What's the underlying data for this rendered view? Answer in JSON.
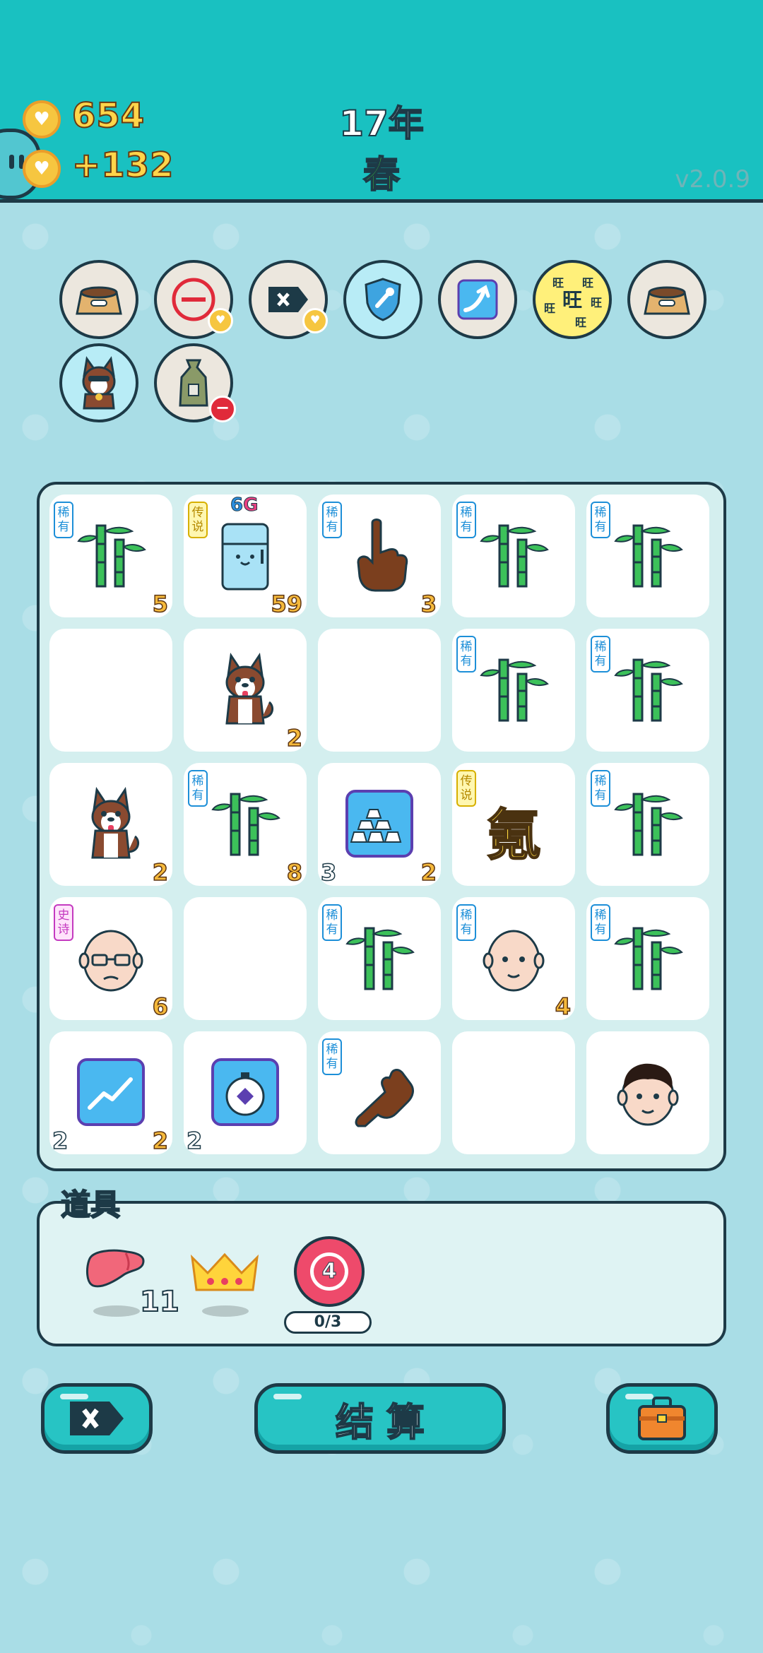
{
  "header": {
    "coins": "654",
    "income": "+132",
    "year": "17年",
    "season": "春",
    "version": "v2.0.9"
  },
  "relics": [
    {
      "name": "pet-food-bowl"
    },
    {
      "name": "no-entry-sign"
    },
    {
      "name": "remove-tag"
    },
    {
      "name": "shield-wrench"
    },
    {
      "name": "arrow-card"
    },
    {
      "name": "wang-coin",
      "text": "旺"
    },
    {
      "name": "pet-food-bowl-2"
    },
    {
      "name": "husky-dog"
    },
    {
      "name": "sack"
    }
  ],
  "tags": {
    "rare": "稀有",
    "legend": "传说",
    "epic": "史诗"
  },
  "board": {
    "cells": [
      {
        "item": "bamboo",
        "tag": "rare",
        "value": "5"
      },
      {
        "item": "fridge",
        "tag": "legend",
        "value": "59",
        "top": "6",
        "top2": "G"
      },
      {
        "item": "pointing-finger",
        "tag": "rare",
        "value": "3"
      },
      {
        "item": "bamboo",
        "tag": "rare",
        "value": ""
      },
      {
        "item": "bamboo",
        "tag": "rare",
        "value": ""
      },
      {
        "item": "empty"
      },
      {
        "item": "husky",
        "value": "2"
      },
      {
        "item": "empty"
      },
      {
        "item": "bamboo",
        "tag": "rare",
        "value": ""
      },
      {
        "item": "bamboo",
        "tag": "rare",
        "value": ""
      },
      {
        "item": "husky",
        "value": "2"
      },
      {
        "item": "bamboo",
        "tag": "rare",
        "value": "8"
      },
      {
        "item": "gold-bars",
        "value": "2",
        "left": "3"
      },
      {
        "item": "kanji",
        "tag": "legend",
        "text": "氪"
      },
      {
        "item": "bamboo",
        "tag": "rare",
        "value": ""
      },
      {
        "item": "old-man",
        "tag": "epic",
        "value": "6"
      },
      {
        "item": "empty"
      },
      {
        "item": "bamboo",
        "tag": "rare",
        "value": ""
      },
      {
        "item": "bald-man",
        "tag": "rare",
        "value": "4"
      },
      {
        "item": "bamboo",
        "tag": "rare",
        "value": ""
      },
      {
        "item": "trend-card",
        "value": "2",
        "left": "2"
      },
      {
        "item": "stopwatch-card",
        "value": "",
        "left": "2"
      },
      {
        "item": "pointing-finger-down",
        "tag": "rare",
        "value": ""
      },
      {
        "item": "empty"
      },
      {
        "item": "young-man",
        "value": ""
      }
    ]
  },
  "props": {
    "title": "道具",
    "items": [
      {
        "name": "liver",
        "count": "11"
      },
      {
        "name": "crown",
        "count": ""
      },
      {
        "name": "target",
        "number": "4",
        "progress": "0/3"
      }
    ]
  },
  "buttons": {
    "remove": "remove-button",
    "settle": "结算",
    "bag": "bag-button"
  },
  "colors": {
    "header": "#19c1c1",
    "background": "#a9dde6",
    "outline": "#1d3a47",
    "number": "#f5b93b"
  }
}
